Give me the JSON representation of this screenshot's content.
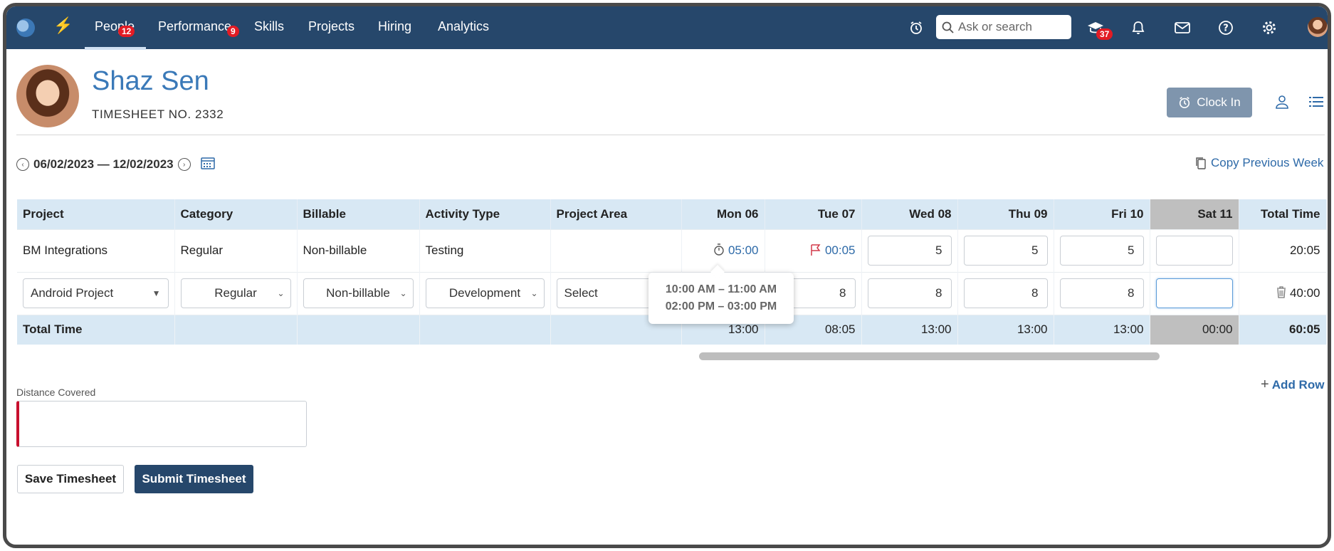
{
  "nav": {
    "tabs": [
      {
        "label": "People",
        "badge": "12",
        "active": true
      },
      {
        "label": "Performance",
        "badge": "9"
      },
      {
        "label": "Skills"
      },
      {
        "label": "Projects"
      },
      {
        "label": "Hiring"
      },
      {
        "label": "Analytics"
      }
    ],
    "search_placeholder": "Ask or search",
    "learning_badge": "37",
    "icons": [
      "logo-icon",
      "bolt-icon",
      "alarm-clock-icon",
      "search-icon",
      "graduation-cap-icon",
      "bell-icon",
      "mail-icon",
      "help-icon",
      "gear-icon"
    ]
  },
  "header": {
    "name": "Shaz Sen",
    "timesheet_no": "TIMESHEET NO. 2332",
    "clock_in_label": "Clock In"
  },
  "date_range": {
    "label": "06/02/2023 — 12/02/2023",
    "copy_previous_label": "Copy Previous Week"
  },
  "table": {
    "columns": [
      "Project",
      "Category",
      "Billable",
      "Activity Type",
      "Project Area",
      "Mon 06",
      "Tue 07",
      "Wed 08",
      "Thu 09",
      "Fri 10",
      "Sat 11",
      "Total Time"
    ],
    "row1": {
      "project": "BM Integrations",
      "category": "Regular",
      "billable": "Non-billable",
      "activity": "Testing",
      "area": "",
      "mon": "05:00",
      "tue": "00:05",
      "wed": "5",
      "thu": "5",
      "fri": "5",
      "sat": "",
      "total": "20:05"
    },
    "row2": {
      "project": "Android Project",
      "category": "Regular",
      "billable": "Non-billable",
      "activity": "Development",
      "area": "Select",
      "tue": "8",
      "wed": "8",
      "thu": "8",
      "fri": "8",
      "sat": "",
      "total": "40:00"
    },
    "totals": {
      "label": "Total Time",
      "mon": "13:00",
      "tue": "08:05",
      "wed": "13:00",
      "thu": "13:00",
      "fri": "13:00",
      "sat": "00:00",
      "total": "60:05"
    }
  },
  "tooltip": {
    "line1": "10:00 AM – 11:00 AM",
    "line2": "02:00 PM – 03:00 PM"
  },
  "add_row_label": "Add Row",
  "distance": {
    "label": "Distance Covered",
    "value": ""
  },
  "buttons": {
    "save": "Save Timesheet",
    "submit": "Submit Timesheet"
  },
  "colors": {
    "nav_bg": "#26476b",
    "accent_blue": "#3a79b8",
    "table_header_bg": "#d8e8f4",
    "badge_red": "#e21b24",
    "saturday_gray": "#bfbfbf"
  }
}
